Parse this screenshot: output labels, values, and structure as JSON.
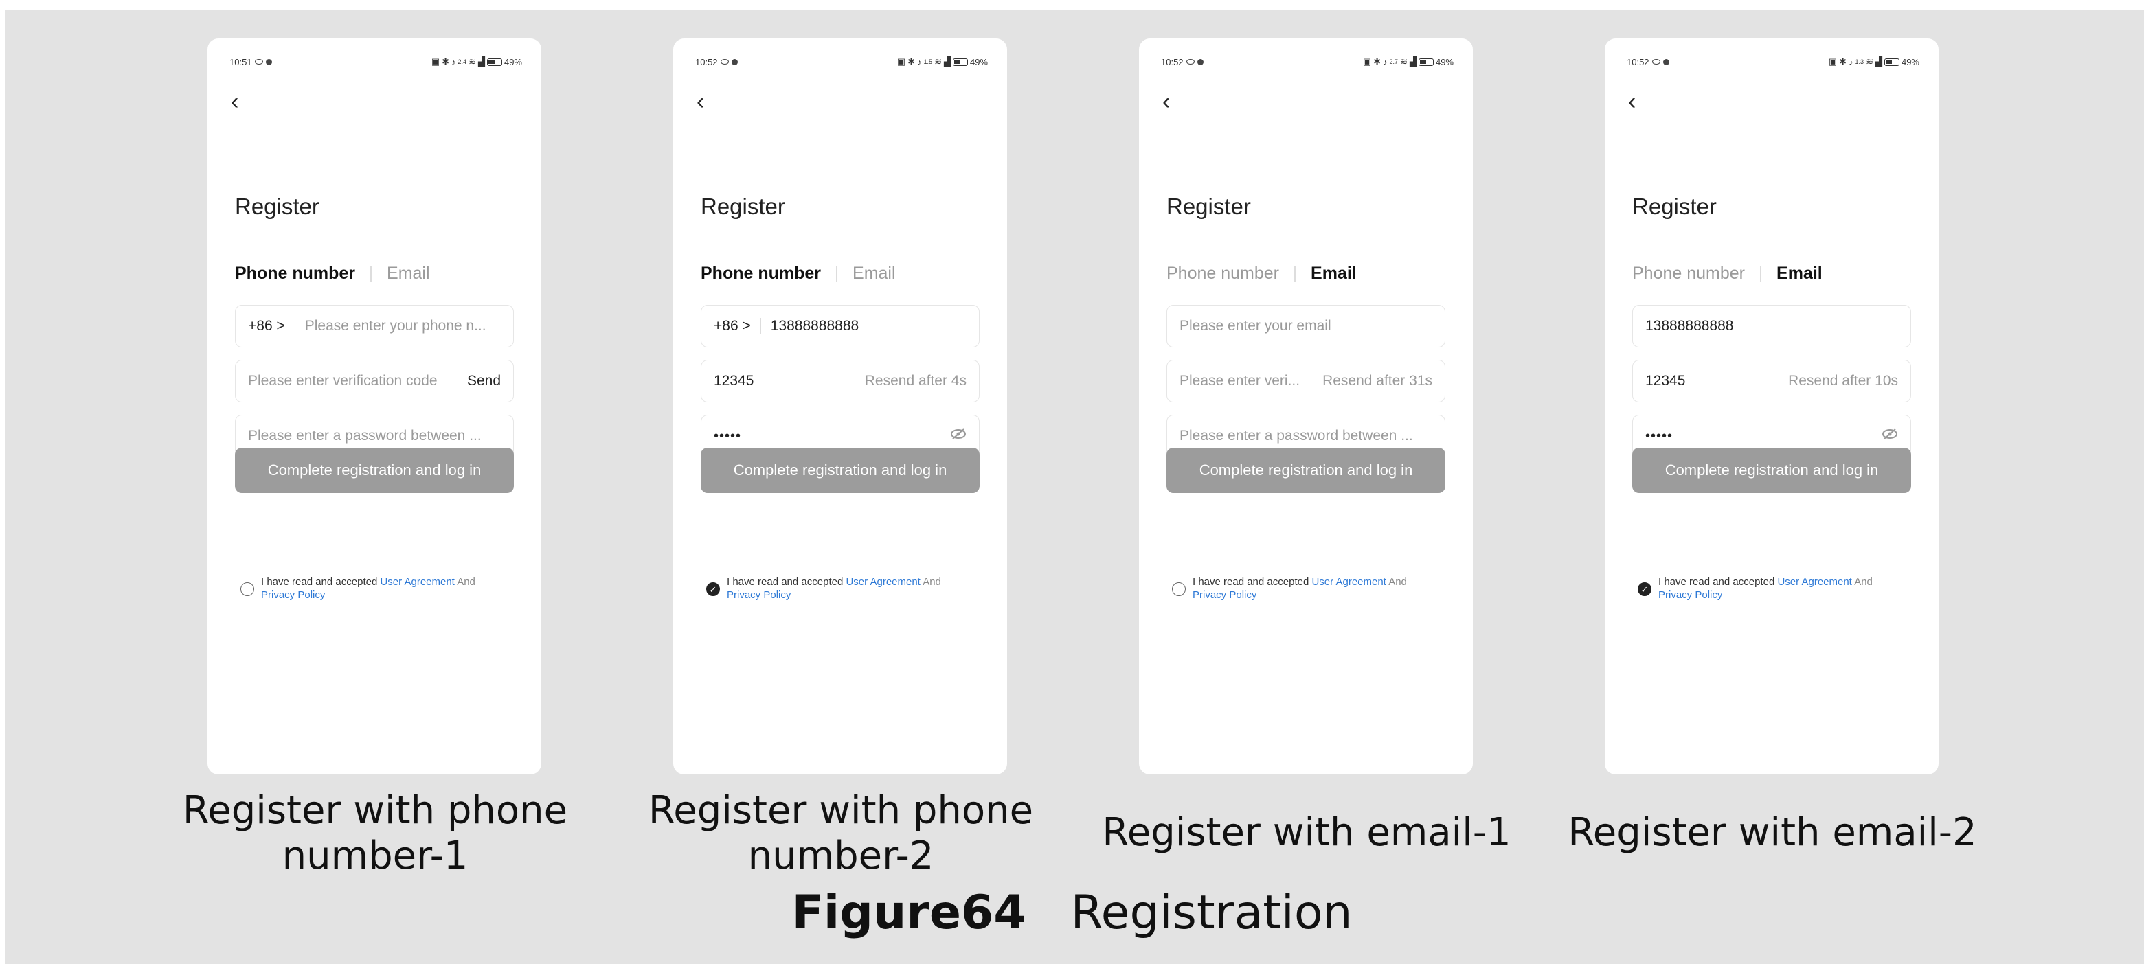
{
  "phones": [
    {
      "time": "10:51",
      "netspeed": "2.4",
      "battery": "49%",
      "title": "Register",
      "tabs": [
        "Phone number",
        "Email"
      ],
      "active_tab": 0,
      "country_code": "+86 >",
      "phone_placeholder": "Please enter your phone n...",
      "code_placeholder": "Please enter verification code",
      "send_label": "Send",
      "password_placeholder": "Please enter a password between ...",
      "button": "Complete registration and log in",
      "agree_prefix": "I have read and accepted",
      "user_agreement": "User Agreement",
      "and": "And",
      "privacy_policy": "Privacy Policy",
      "checked": false,
      "caption": "Register   with phone number-1"
    },
    {
      "time": "10:52",
      "netspeed": "1.5",
      "battery": "49%",
      "title": "Register",
      "tabs": [
        "Phone number",
        "Email"
      ],
      "active_tab": 0,
      "country_code": "+86 >",
      "phone_value": "13888888888",
      "code_value": "12345",
      "resend_label": "Resend after 4s",
      "password_value": "•••••",
      "button": "Complete registration and log in",
      "agree_prefix": "I have read and accepted",
      "user_agreement": "User Agreement",
      "and": "And",
      "privacy_policy": "Privacy Policy",
      "checked": true,
      "caption": "Register   with phone number-2"
    },
    {
      "time": "10:52",
      "netspeed": "2.7",
      "battery": "49%",
      "title": "Register",
      "tabs": [
        "Phone number",
        "Email"
      ],
      "active_tab": 1,
      "email_placeholder": "Please enter your email",
      "code_placeholder": "Please enter veri...",
      "resend_label": "Resend after 31s",
      "password_placeholder": "Please enter a password between ...",
      "button": "Complete registration and log in",
      "agree_prefix": "I have read and accepted",
      "user_agreement": "User Agreement",
      "and": "And",
      "privacy_policy": "Privacy Policy",
      "checked": false,
      "caption": "Register   with email-1"
    },
    {
      "time": "10:52",
      "netspeed": "1.3",
      "battery": "49%",
      "title": "Register",
      "tabs": [
        "Phone number",
        "Email"
      ],
      "active_tab": 1,
      "email_value": "13888888888",
      "code_value": "12345",
      "resend_label": "Resend after 10s",
      "password_value": "•••••",
      "button": "Complete registration and log in",
      "agree_prefix": "I have read and accepted",
      "user_agreement": "User Agreement",
      "and": "And",
      "privacy_policy": "Privacy Policy",
      "checked": true,
      "caption": "Register   with email-2"
    }
  ],
  "figure": {
    "number": "Figure64",
    "title": "Registration"
  },
  "colors": {
    "background": "#e3e3e3",
    "button": "#9c9c9c",
    "link": "#2f7ad6"
  }
}
